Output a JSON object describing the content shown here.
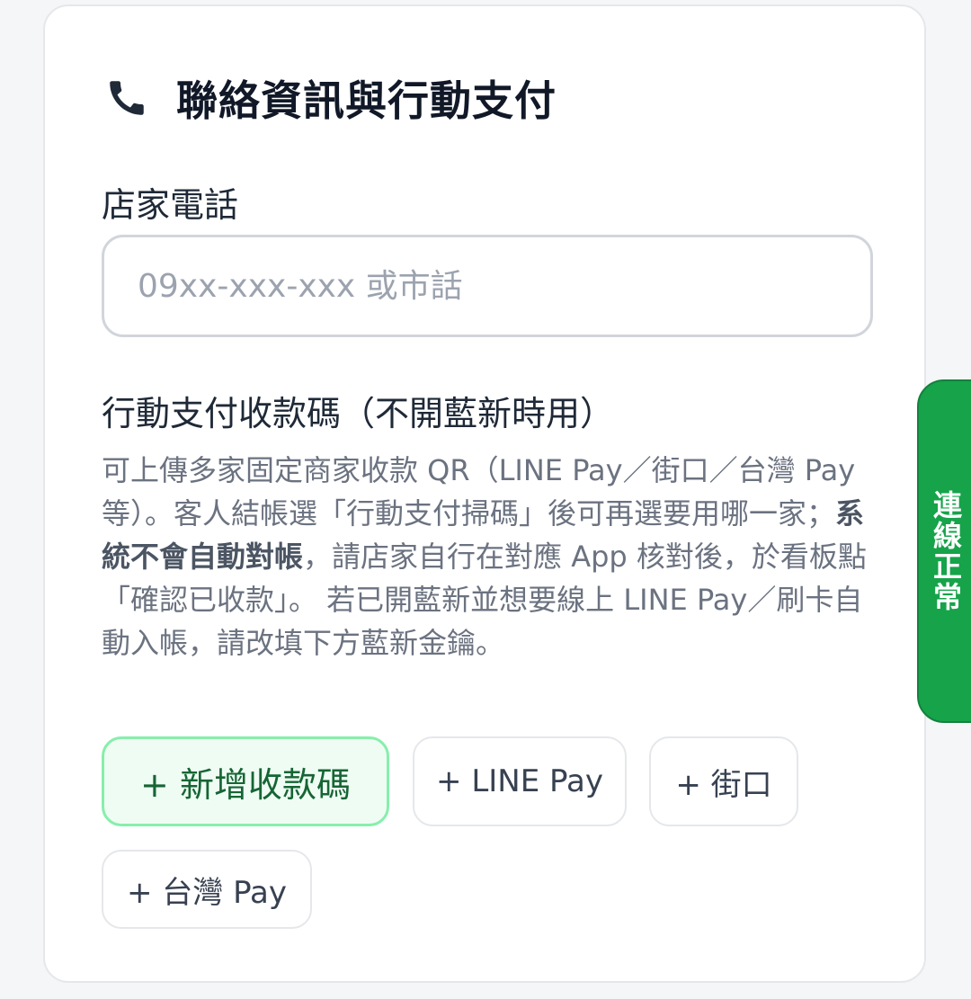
{
  "card": {
    "title_icon": "phone-icon",
    "title": "聯絡資訊與行動支付"
  },
  "phone": {
    "label": "店家電話",
    "placeholder": "09xx-xxx-xxx 或市話",
    "value": ""
  },
  "qr": {
    "label": "行動支付收款碼（不開藍新時用）",
    "desc_part1": "可上傳多家固定商家收款 QR（LINE Pay／街口／台灣 Pay 等）。客人結帳選「行動支付掃碼」後可再選要用哪一家；",
    "desc_bold": "系統不會自動對帳",
    "desc_part2": "，請店家自行在對應 App 核對後，於看板點「確認已收款」。 若已開藍新並想要線上 LINE Pay／刷卡自動入帳，請改填下方藍新金鑰。"
  },
  "buttons": {
    "add": "+ 新增收款碼",
    "line_pay": "+ LINE Pay",
    "jkopay": "+ 街口",
    "taiwan_pay": "+ 台灣 Pay"
  },
  "status": {
    "label": "連線正常",
    "color": "#16a34a"
  },
  "colors": {
    "accent_green": "#16a34a",
    "add_button_bg": "#effcf3",
    "add_button_border": "#86efac"
  }
}
